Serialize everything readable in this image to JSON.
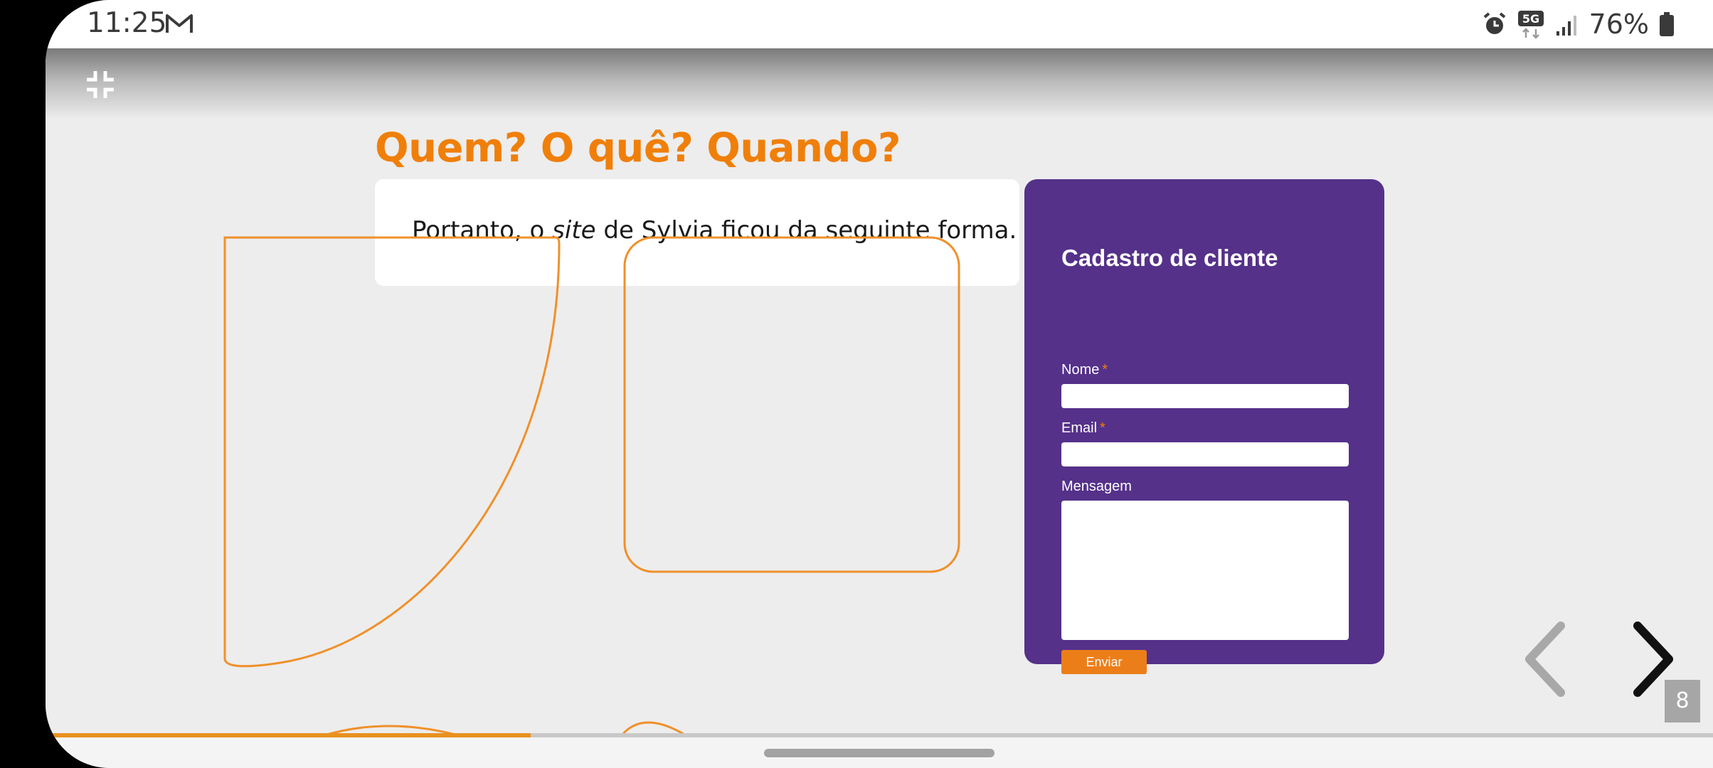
{
  "status_bar": {
    "time": "11:25",
    "network": "5G",
    "battery": "76%",
    "icons": [
      "gmail-icon",
      "alarm-icon",
      "5g-data-icon",
      "signal-icon",
      "battery-icon"
    ]
  },
  "slide": {
    "heading": "Quem? O quê? Quando?",
    "intro_before": "Portanto, o ",
    "intro_em": "site",
    "intro_after": " de Sylvia ficou da seguinte forma."
  },
  "form": {
    "title": "Cadastro de cliente",
    "name_label": "Nome",
    "email_label": "Email",
    "message_label": "Mensagem",
    "required_mark": "*",
    "submit_label": "Enviar"
  },
  "navigation": {
    "page_number": "8",
    "progress_percent": 29.1
  },
  "colors": {
    "accent_orange": "#f07f0a",
    "form_purple": "#55318a",
    "background": "#ededed"
  }
}
